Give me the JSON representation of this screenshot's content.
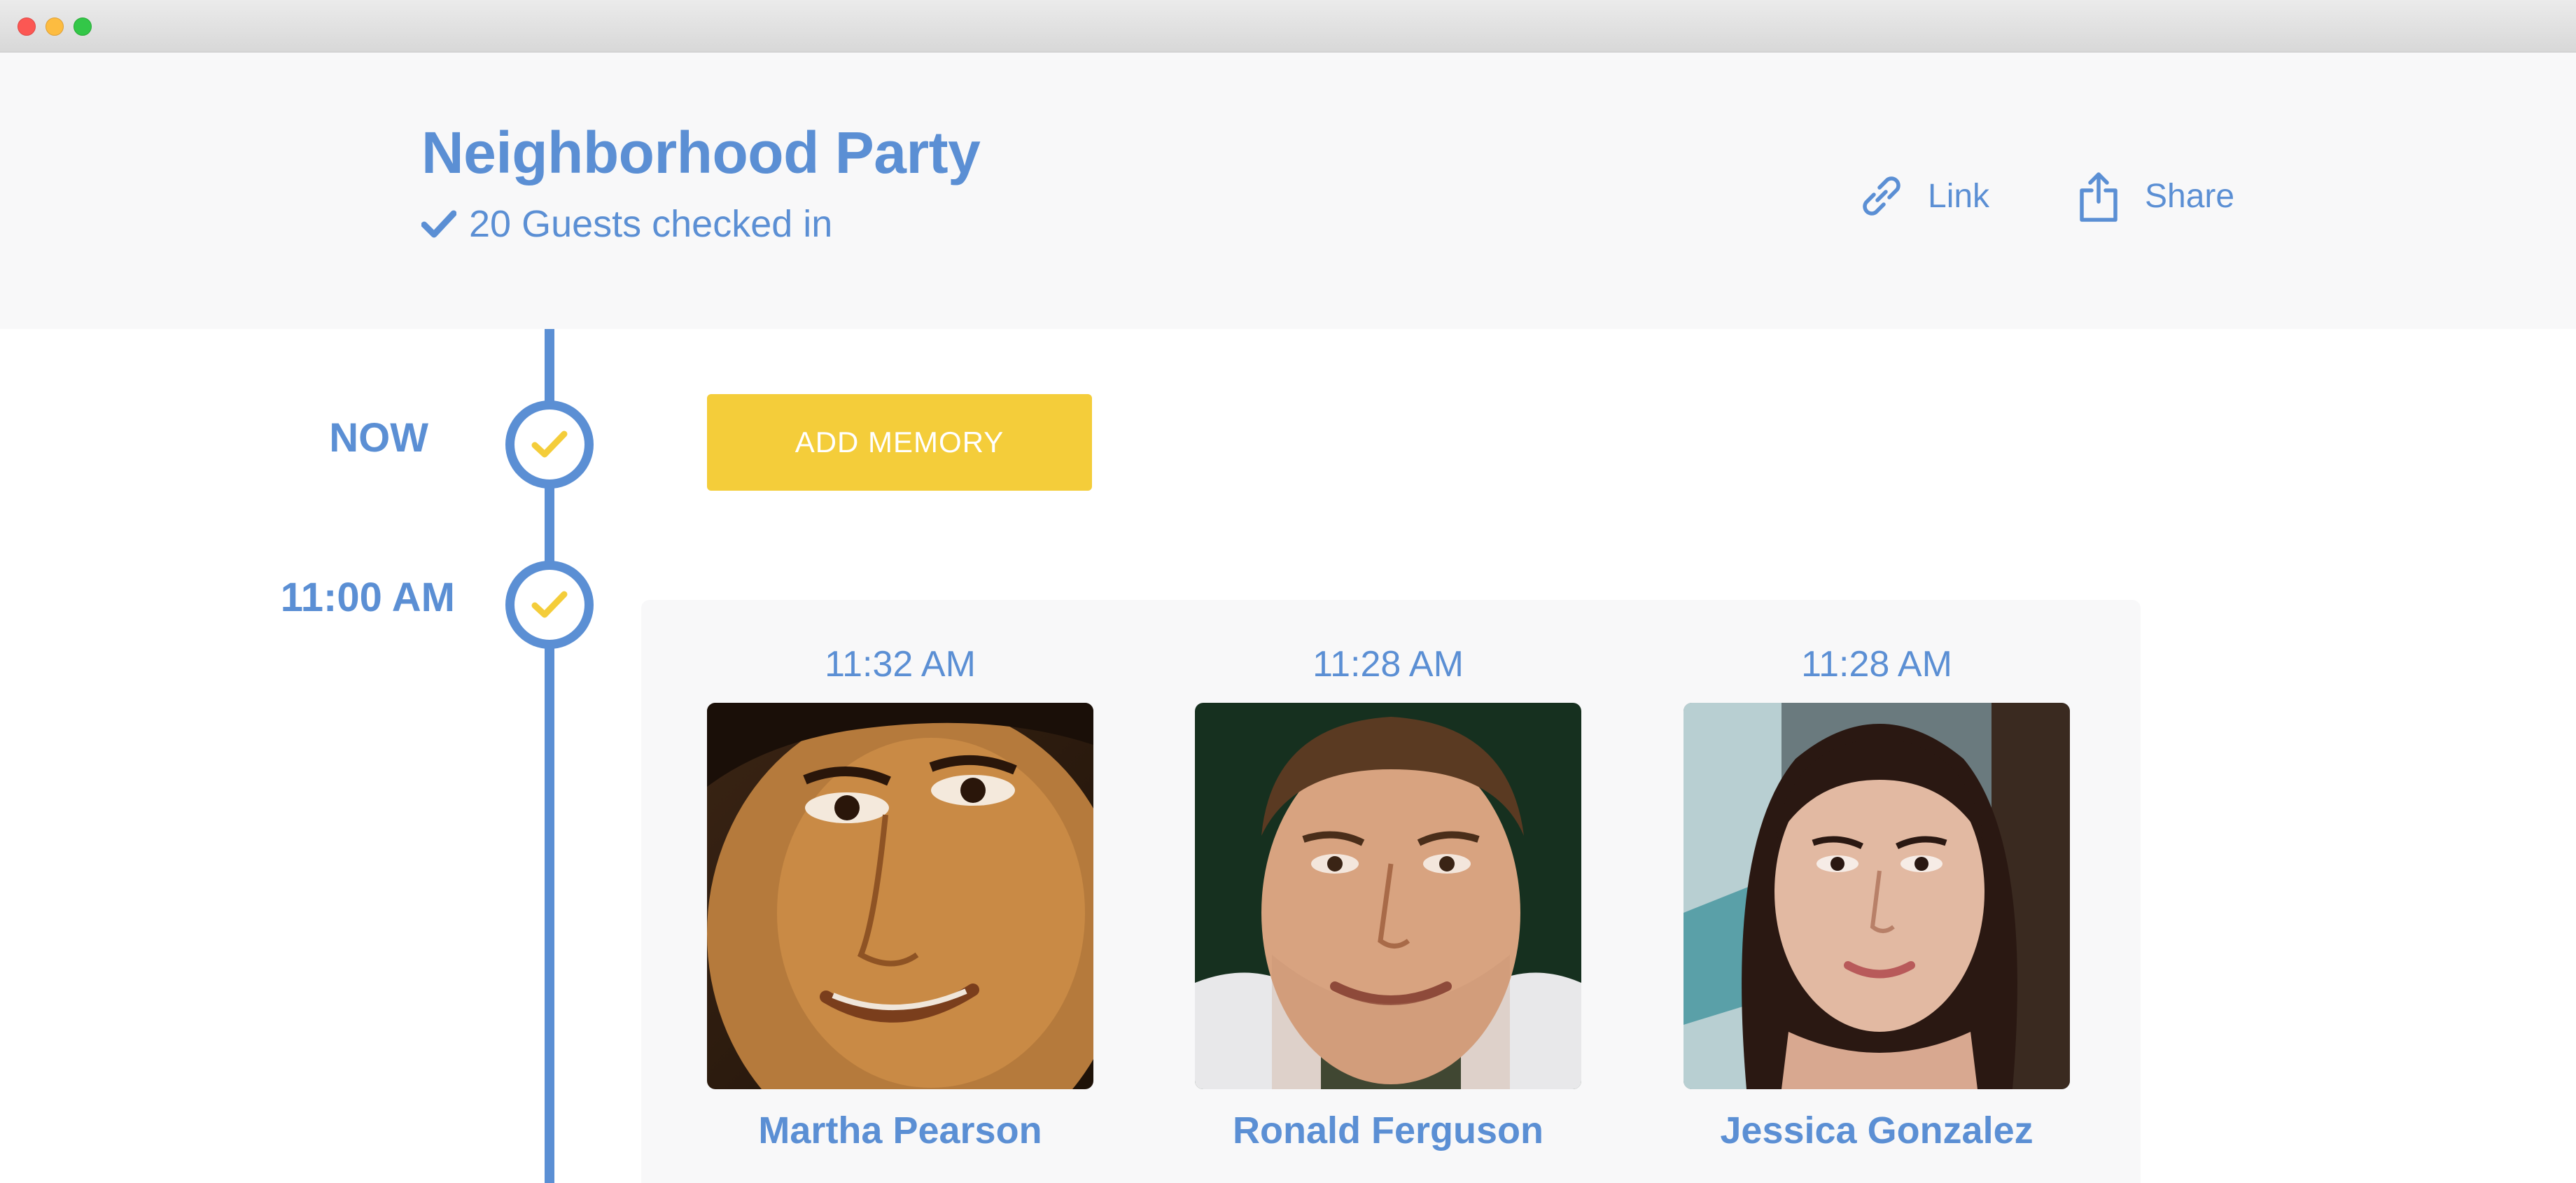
{
  "event": {
    "title": "Neighborhood Party",
    "checked_in_text": "20 Guests checked in"
  },
  "actions": {
    "link_label": "Link",
    "share_label": "Share"
  },
  "timeline": {
    "now_label": "NOW",
    "slot_label": "11:00 AM",
    "add_memory_label": "ADD MEMORY"
  },
  "memories": [
    {
      "time": "11:32 AM",
      "name": "Martha Pearson"
    },
    {
      "time": "11:28 AM",
      "name": "Ronald Ferguson"
    },
    {
      "time": "11:28 AM",
      "name": "Jessica Gonzalez"
    }
  ],
  "colors": {
    "accent_blue": "#5b8fd4",
    "button_yellow": "#f4cd3a",
    "header_background": "#f8f8f9"
  },
  "icons": [
    "check-icon",
    "link-icon",
    "share-icon",
    "timeline-check-icon"
  ]
}
